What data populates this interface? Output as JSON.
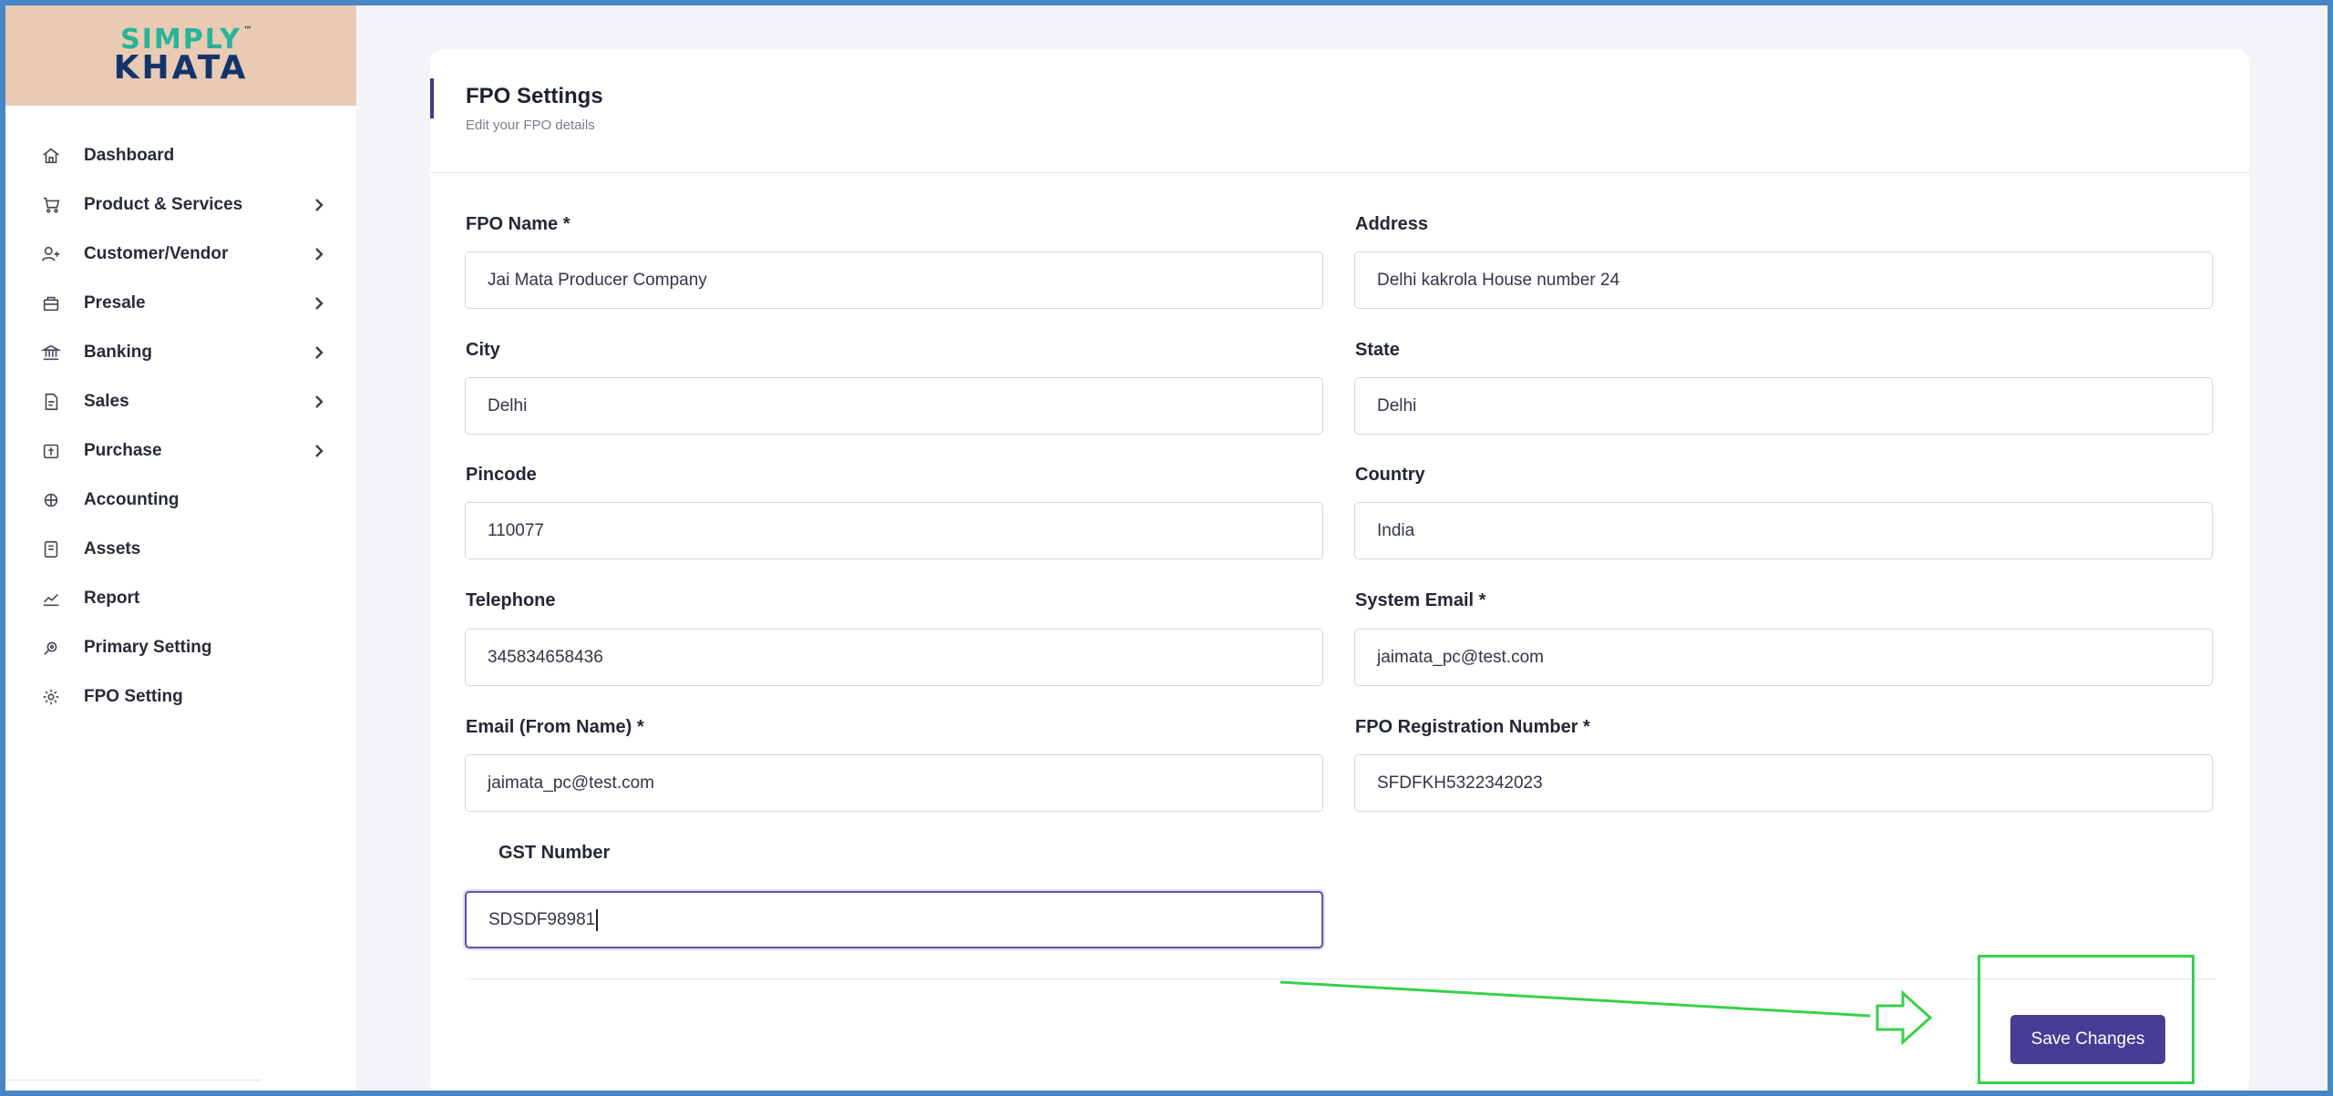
{
  "brand": {
    "logo_top": "SIMPLY",
    "logo_bottom": "KHATA",
    "logo_tm": "™"
  },
  "sidebar": {
    "items": [
      {
        "label": "Dashboard",
        "icon": "home-icon",
        "has_submenu": false
      },
      {
        "label": "Product & Services",
        "icon": "cart-icon",
        "has_submenu": true
      },
      {
        "label": "Customer/Vendor",
        "icon": "user-plus-icon",
        "has_submenu": true
      },
      {
        "label": "Presale",
        "icon": "bag-icon",
        "has_submenu": true
      },
      {
        "label": "Banking",
        "icon": "bank-icon",
        "has_submenu": true
      },
      {
        "label": "Sales",
        "icon": "sales-doc-icon",
        "has_submenu": true
      },
      {
        "label": "Purchase",
        "icon": "purchase-icon",
        "has_submenu": true
      },
      {
        "label": "Accounting",
        "icon": "accounting-icon",
        "has_submenu": false
      },
      {
        "label": "Assets",
        "icon": "assets-icon",
        "has_submenu": false
      },
      {
        "label": "Report",
        "icon": "chart-icon",
        "has_submenu": false
      },
      {
        "label": "Primary Setting",
        "icon": "settings-hand-icon",
        "has_submenu": false
      },
      {
        "label": "FPO Setting",
        "icon": "gear-icon",
        "has_submenu": false
      }
    ]
  },
  "page": {
    "title": "FPO Settings",
    "subtitle": "Edit your FPO details"
  },
  "form": {
    "fpo_name": {
      "label": "FPO Name *",
      "value": "Jai Mata Producer Company"
    },
    "address": {
      "label": "Address",
      "value": "Delhi kakrola House number 24"
    },
    "city": {
      "label": "City",
      "value": "Delhi"
    },
    "state": {
      "label": "State",
      "value": "Delhi"
    },
    "pincode": {
      "label": "Pincode",
      "value": "110077"
    },
    "country": {
      "label": "Country",
      "value": "India"
    },
    "telephone": {
      "label": "Telephone",
      "value": "345834658436"
    },
    "system_email": {
      "label": "System Email *",
      "value": "jaimata_pc@test.com"
    },
    "email_from": {
      "label": "Email (From Name) *",
      "value": "jaimata_pc@test.com"
    },
    "registration": {
      "label": "FPO Registration Number *",
      "value": "SFDFKH5322342023"
    },
    "gst": {
      "label": "GST Number",
      "value": "SDSDF98981"
    }
  },
  "actions": {
    "save_label": "Save Changes"
  },
  "colors": {
    "accent": "#453c95",
    "sidebar_brand_bg": "#e9cbb4",
    "annotation": "#36d24a",
    "frame": "#4a86c6"
  }
}
